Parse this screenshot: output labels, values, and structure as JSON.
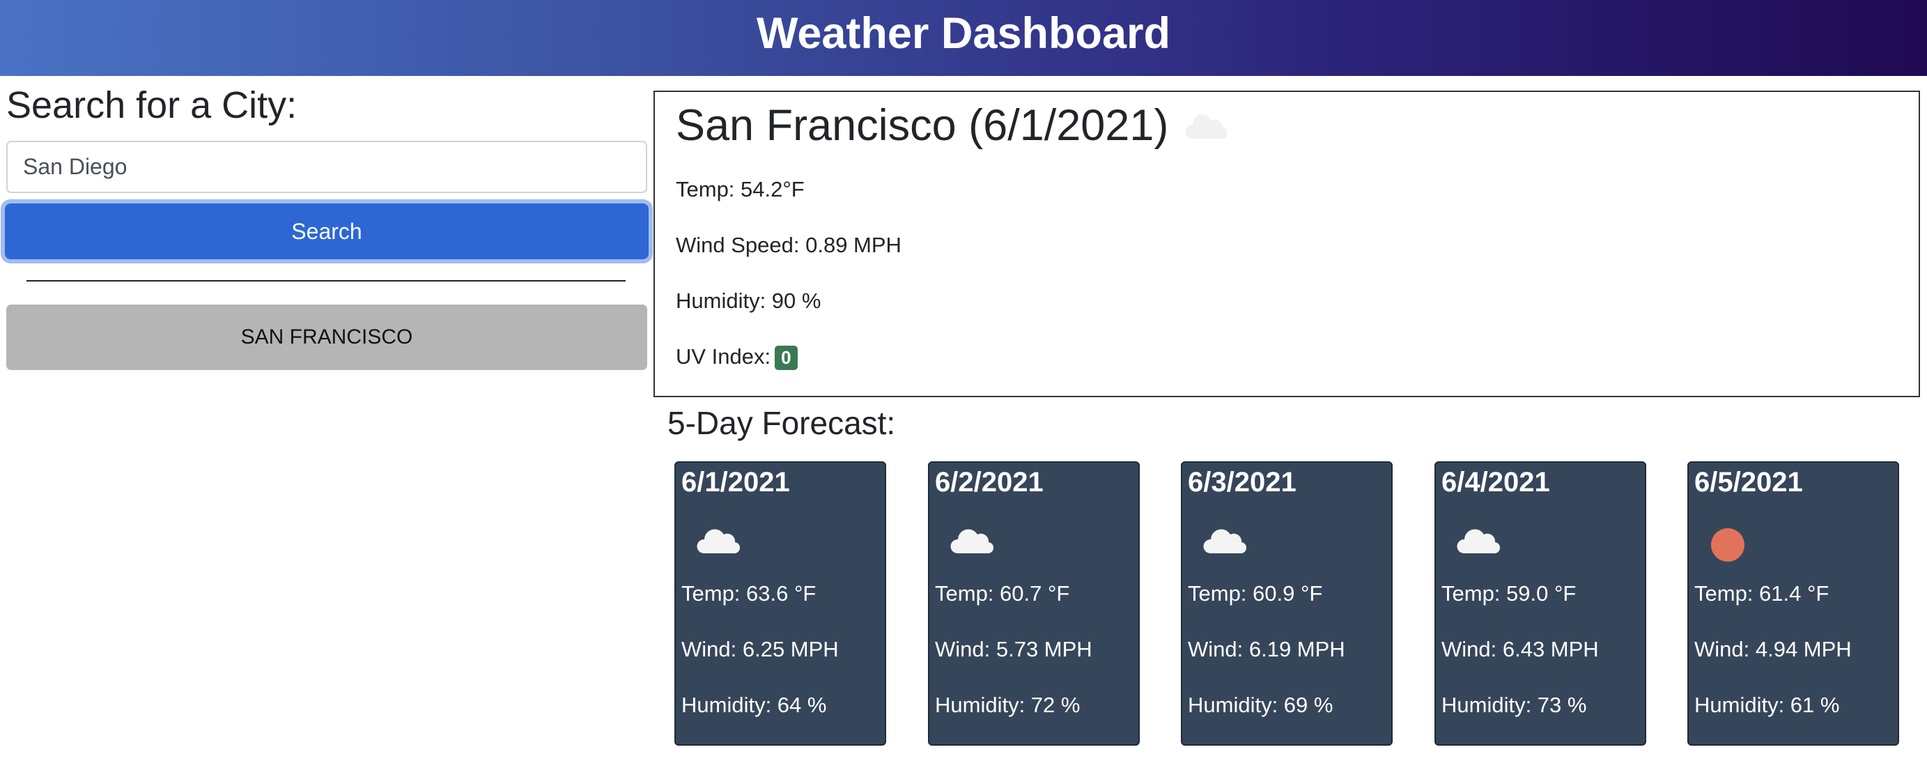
{
  "header": {
    "title": "Weather Dashboard"
  },
  "search": {
    "title": "Search for a City:",
    "input_value": "San Diego",
    "placeholder": "San Diego",
    "button_label": "Search"
  },
  "history": [
    "SAN FRANCISCO"
  ],
  "current": {
    "city_date": "San Francisco (6/1/2021)",
    "icon": "cloud-icon",
    "temp": "Temp: 54.2°F",
    "wind": "Wind Speed: 0.89 MPH",
    "humidity": "Humidity: 90 %",
    "uv_label": "UV Index:",
    "uv_value": "0",
    "uv_color": "#3a7a52"
  },
  "forecast": {
    "title": "5-Day Forecast:",
    "card_color": "#36465a",
    "days": [
      {
        "date": "6/1/2021",
        "icon": "cloud-icon",
        "temp": "Temp: 63.6 °F",
        "wind": "Wind: 6.25 MPH",
        "humidity": "Humidity: 64 %"
      },
      {
        "date": "6/2/2021",
        "icon": "cloud-icon",
        "temp": "Temp: 60.7 °F",
        "wind": "Wind: 5.73 MPH",
        "humidity": "Humidity: 72 %"
      },
      {
        "date": "6/3/2021",
        "icon": "cloud-icon",
        "temp": "Temp: 60.9 °F",
        "wind": "Wind: 6.19 MPH",
        "humidity": "Humidity: 69 %"
      },
      {
        "date": "6/4/2021",
        "icon": "cloud-icon",
        "temp": "Temp: 59.0 °F",
        "wind": "Wind: 6.43 MPH",
        "humidity": "Humidity: 73 %"
      },
      {
        "date": "6/5/2021",
        "icon": "sun-icon",
        "temp": "Temp: 61.4 °F",
        "wind": "Wind: 4.94 MPH",
        "humidity": "Humidity: 61 %"
      }
    ]
  },
  "colors": {
    "header_gradient": [
      "#4a72c4",
      "#1f0a52"
    ],
    "search_button": "#2c67d4",
    "history_button": "#b5b5b5",
    "sun": "#e0735a"
  }
}
